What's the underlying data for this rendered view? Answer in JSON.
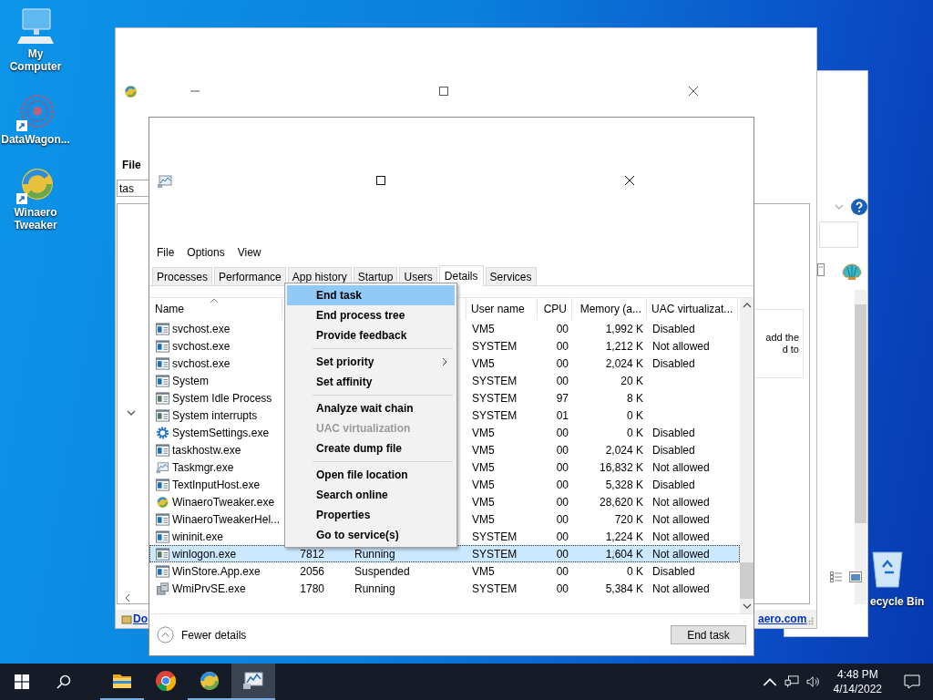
{
  "desktop_icons": [
    {
      "label": "My Computer",
      "kind": "computer"
    },
    {
      "label": "DataWagon...",
      "kind": "pattern"
    },
    {
      "label": "Winaero Tweaker",
      "kind": "tweaker"
    }
  ],
  "recycle_bin": {
    "label": "ecycle Bin"
  },
  "background_window": {
    "menu": [
      "File"
    ],
    "search": {
      "value": "tas"
    },
    "link_left": "Do",
    "link_right": "aero.com",
    "note_lines": [
      "add the",
      "d to"
    ]
  },
  "task_manager": {
    "menu": [
      "File",
      "Options",
      "View"
    ],
    "tabs": [
      {
        "label": "Processes",
        "selected": false
      },
      {
        "label": "Performance",
        "selected": false
      },
      {
        "label": "App history",
        "selected": false
      },
      {
        "label": "Startup",
        "selected": false
      },
      {
        "label": "Users",
        "selected": false
      },
      {
        "label": "Details",
        "selected": true
      },
      {
        "label": "Services",
        "selected": false
      }
    ],
    "columns": [
      {
        "label": "Name",
        "sorted": true
      },
      {
        "label": "User name",
        "sorted": false
      },
      {
        "label": "CPU",
        "sorted": false
      },
      {
        "label": "Memory (a...",
        "sorted": false
      },
      {
        "label": "UAC virtualizat...",
        "sorted": false
      }
    ],
    "rows": [
      {
        "kind": "app",
        "name": "svchost.exe",
        "user": "VM5",
        "cpu": "00",
        "memory": "1,992 K",
        "uac": "Disabled",
        "selected": false
      },
      {
        "kind": "app",
        "name": "svchost.exe",
        "user": "SYSTEM",
        "cpu": "00",
        "memory": "1,212 K",
        "uac": "Not allowed",
        "selected": false
      },
      {
        "kind": "app",
        "name": "svchost.exe",
        "user": "VM5",
        "cpu": "00",
        "memory": "2,024 K",
        "uac": "Disabled",
        "selected": false
      },
      {
        "kind": "app",
        "name": "System",
        "user": "SYSTEM",
        "cpu": "00",
        "memory": "20 K",
        "selected": false
      },
      {
        "kind": "grey",
        "name": "System Idle Process",
        "user": "SYSTEM",
        "cpu": "97",
        "memory": "8 K",
        "selected": false
      },
      {
        "kind": "grey",
        "name": "System interrupts",
        "user": "SYSTEM",
        "cpu": "01",
        "memory": "0 K",
        "selected": false
      },
      {
        "kind": "gear",
        "name": "SystemSettings.exe",
        "user": "VM5",
        "cpu": "00",
        "memory": "0 K",
        "uac": "Disabled",
        "selected": false
      },
      {
        "kind": "app",
        "name": "taskhostw.exe",
        "user": "VM5",
        "cpu": "00",
        "memory": "2,024 K",
        "uac": "Disabled",
        "selected": false
      },
      {
        "kind": "monitor",
        "name": "Taskmgr.exe",
        "user": "VM5",
        "cpu": "00",
        "memory": "16,832 K",
        "uac": "Not allowed",
        "selected": false
      },
      {
        "kind": "app",
        "name": "TextInputHost.exe",
        "user": "VM5",
        "cpu": "00",
        "memory": "5,328 K",
        "uac": "Disabled",
        "selected": false
      },
      {
        "kind": "tweaker",
        "name": "WinaeroTweaker.exe",
        "user": "VM5",
        "cpu": "00",
        "memory": "28,620 K",
        "uac": "Not allowed",
        "selected": false
      },
      {
        "kind": "app",
        "name": "WinaeroTweakerHel...",
        "user": "VM5",
        "cpu": "00",
        "memory": "720 K",
        "uac": "Not allowed",
        "selected": false
      },
      {
        "kind": "app",
        "name": "wininit.exe",
        "user": "SYSTEM",
        "cpu": "00",
        "memory": "1,224 K",
        "uac": "Not allowed",
        "selected": false
      },
      {
        "kind": "grey",
        "name": "winlogon.exe",
        "pid": "7812",
        "status": "Running",
        "user": "SYSTEM",
        "cpu": "00",
        "memory": "1,604 K",
        "uac": "Not allowed",
        "selected": true
      },
      {
        "kind": "app",
        "name": "WinStore.App.exe",
        "pid": "2056",
        "status": "Suspended",
        "user": "VM5",
        "cpu": "00",
        "memory": "0 K",
        "uac": "Disabled",
        "selected": false
      },
      {
        "kind": "wmi",
        "name": "WmiPrvSE.exe",
        "pid": "1780",
        "status": "Running",
        "user": "SYSTEM",
        "cpu": "00",
        "memory": "5,384 K",
        "uac": "Not allowed",
        "selected": false
      }
    ],
    "context_menu": [
      {
        "kind": "item",
        "label": "End task",
        "selected": true,
        "disabled": false
      },
      {
        "kind": "item",
        "label": "End process tree",
        "selected": false,
        "disabled": false
      },
      {
        "kind": "item",
        "label": "Provide feedback",
        "selected": false,
        "disabled": false
      },
      {
        "kind": "separator"
      },
      {
        "kind": "submenu",
        "label": "Set priority",
        "selected": false,
        "disabled": false
      },
      {
        "kind": "item",
        "label": "Set affinity",
        "selected": false,
        "disabled": false
      },
      {
        "kind": "separator"
      },
      {
        "kind": "item",
        "label": "Analyze wait chain",
        "selected": false,
        "disabled": false
      },
      {
        "kind": "item",
        "label": "UAC virtualization",
        "selected": false,
        "disabled": true
      },
      {
        "kind": "item",
        "label": "Create dump file",
        "selected": false,
        "disabled": false
      },
      {
        "kind": "separator"
      },
      {
        "kind": "item",
        "label": "Open file location",
        "selected": false,
        "disabled": false
      },
      {
        "kind": "item",
        "label": "Search online",
        "selected": false,
        "disabled": false
      },
      {
        "kind": "item",
        "label": "Properties",
        "selected": false,
        "disabled": false
      },
      {
        "kind": "item",
        "label": "Go to service(s)",
        "selected": false,
        "disabled": false
      }
    ],
    "footer": {
      "toggle": "Fewer details",
      "button": "End task"
    }
  },
  "taskbar": {
    "apps": [
      {
        "kind": "folder",
        "running": true,
        "selected": false
      },
      {
        "kind": "browser",
        "running": false,
        "selected": false
      },
      {
        "kind": "tweaker",
        "running": true,
        "selected": false
      },
      {
        "kind": "monitor",
        "running": true,
        "selected": true
      }
    ],
    "time": "4:48 PM",
    "date": "4/14/2022"
  }
}
